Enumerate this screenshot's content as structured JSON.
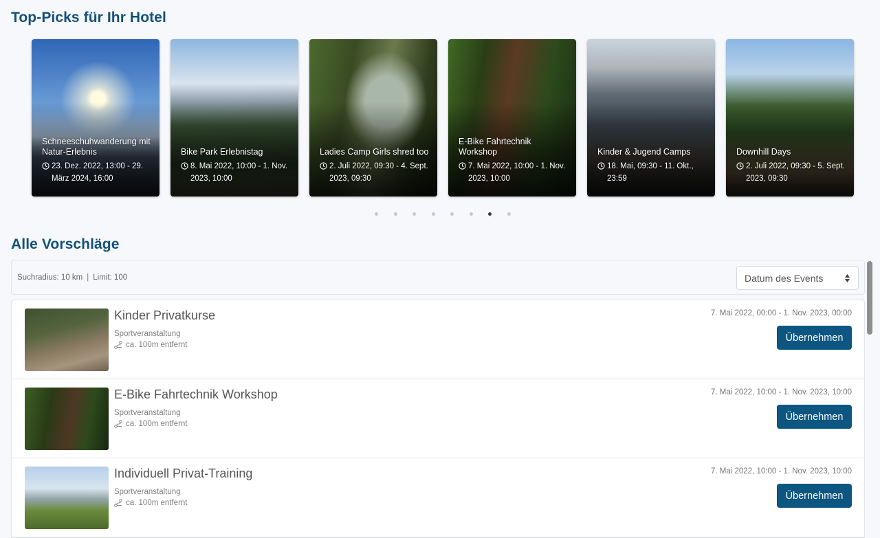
{
  "sections": {
    "top_picks_title": "Top-Picks für Ihr Hotel",
    "all_title": "Alle Vorschläge"
  },
  "top_picks": [
    {
      "title": "Schneeschuhwanderung mit Natur-Erlebnis",
      "date": "23. Dez. 2022, 13:00 - 29. März 2024, 16:00"
    },
    {
      "title": "Bike Park Erlebnistag",
      "date": "8. Mai 2022, 10:00 - 1. Nov. 2023, 10:00"
    },
    {
      "title": "Ladies Camp Girls shred too",
      "date": "2. Juli 2022, 09:30 - 4. Sept. 2023, 09:30"
    },
    {
      "title": "E-Bike Fahrtechnik Workshop",
      "date": "7. Mai 2022, 10:00 - 1. Nov. 2023, 10:00"
    },
    {
      "title": "Kinder & Jugend Camps",
      "date": "18. Mai, 09:30 - 11. Okt., 23:59"
    },
    {
      "title": "Downhill Days",
      "date": "2. Juli 2022, 09:30 - 5. Sept. 2023, 09:30"
    }
  ],
  "carousel": {
    "dot_count": 8,
    "active_dot": 7
  },
  "filter": {
    "radius": "Suchradius: 10 km",
    "separator": "|",
    "limit": "Limit: 100",
    "sort_selected": "Datum des Events"
  },
  "items": [
    {
      "title": "Kinder Privatkurse",
      "category": "Sportveranstaltung",
      "distance": "ca. 100m entfernt",
      "date": "7. Mai 2022, 00:00 - 1. Nov. 2023, 00:00",
      "button": "Übernehmen"
    },
    {
      "title": "E-Bike Fahrtechnik Workshop",
      "category": "Sportveranstaltung",
      "distance": "ca. 100m entfernt",
      "date": "7. Mai 2022, 10:00 - 1. Nov. 2023, 10:00",
      "button": "Übernehmen"
    },
    {
      "title": "Individuell Privat-Training",
      "category": "Sportveranstaltung",
      "distance": "ca. 100m entfernt",
      "date": "7. Mai 2022, 10:00 - 1. Nov. 2023, 10:00",
      "button": "Übernehmen"
    }
  ],
  "icons": {
    "date": "clock-icon",
    "distance": "route-icon",
    "sort": "sort-arrows-icon"
  },
  "colors": {
    "accent": "#13507a",
    "button": "#0d5682",
    "background": "#f6f8fb"
  }
}
